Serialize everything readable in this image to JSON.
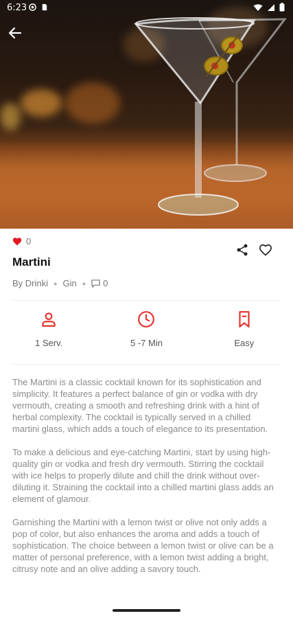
{
  "status": {
    "time": "6:23"
  },
  "recipe": {
    "title": "Martini",
    "likes": "0",
    "author": "By Drinki",
    "category": "Gin",
    "comments": "0"
  },
  "stats": {
    "servings": "1 Serv.",
    "time": "5 -7 Min",
    "difficulty": "Easy"
  },
  "description": {
    "p1": "The Martini is a classic cocktail known for its sophistication and simplicity. It features a perfect balance of gin or vodka with dry vermouth, creating a smooth and refreshing drink with a hint of herbal complexity. The cocktail is typically served in a chilled martini glass, which adds a touch of elegance to its presentation.",
    "p2": "To make a delicious and eye-catching Martini, start by using high-quality gin or vodka and fresh dry vermouth. Stirring the cocktail with ice helps to properly dilute and chill the drink without over-diluting it. Straining the cocktail into a chilled martini glass adds an element of glamour.",
    "p3": "Garnishing the Martini with a lemon twist or olive not only adds a pop of color, but also enhances the aroma and adds a touch of sophistication. The choice between a lemon twist or olive can be a matter of personal preference, with a lemon twist adding a bright, citrusy note and an olive adding a savory touch."
  },
  "colors": {
    "accent": "#e5322d",
    "heart": "#e21b23"
  }
}
